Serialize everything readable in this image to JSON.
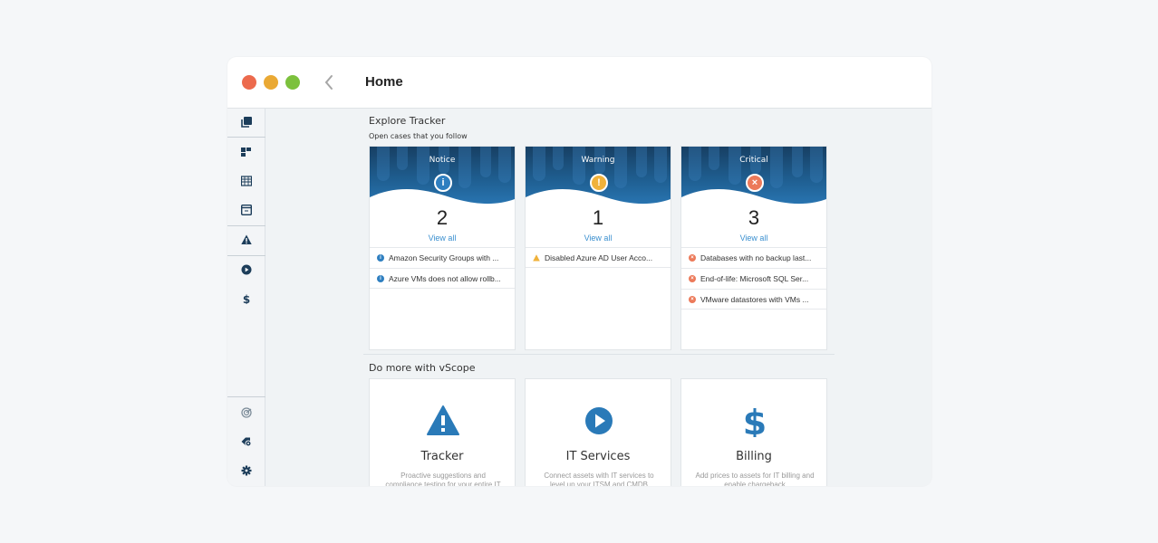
{
  "window": {
    "title": "Home",
    "controls": [
      "close",
      "minimize",
      "maximize"
    ],
    "back_icon": "chevron-left-icon"
  },
  "sidebar": {
    "top_items": [
      {
        "icon": "inventory-icon",
        "label": "Inventory"
      },
      {
        "icon": "dashboards-icon",
        "label": "Dashboards"
      },
      {
        "icon": "table-icon",
        "label": "Tables"
      },
      {
        "icon": "window-icon",
        "label": "Views"
      },
      {
        "icon": "warning-triangle-icon",
        "label": "Tracker"
      },
      {
        "icon": "play-circle-icon",
        "label": "IT Services"
      },
      {
        "icon": "dollar-icon",
        "label": "Billing"
      }
    ],
    "bottom_items": [
      {
        "icon": "discovery-icon",
        "label": "Discovery"
      },
      {
        "icon": "tags-settings-icon",
        "label": "Tags"
      },
      {
        "icon": "gear-icon",
        "label": "Settings"
      }
    ]
  },
  "explore": {
    "title": "Explore Tracker",
    "subtitle": "Open cases that you follow",
    "cards": [
      {
        "label": "Notice",
        "count": "2",
        "view_all": "View all",
        "icon": "info-icon",
        "color": "#2f7fc0",
        "items": [
          "Amazon Security Groups with ...",
          "Azure VMs does not allow rollb..."
        ]
      },
      {
        "label": "Warning",
        "count": "1",
        "view_all": "View all",
        "icon": "warning-icon",
        "color": "#f0b23b",
        "items": [
          "Disabled Azure AD User Acco..."
        ]
      },
      {
        "label": "Critical",
        "count": "3",
        "view_all": "View all",
        "icon": "error-icon",
        "color": "#ec7a5a",
        "items": [
          "Databases with no backup last...",
          "End-of-life: Microsoft SQL Ser...",
          "VMware datastores with VMs ..."
        ]
      }
    ]
  },
  "more": {
    "title": "Do more with vScope",
    "features": [
      {
        "title": "Tracker",
        "desc": "Proactive suggestions and compliance testing for your entire IT",
        "icon": "warning-triangle-icon"
      },
      {
        "title": "IT Services",
        "desc": "Connect assets with IT services to level up your ITSM and CMDB",
        "icon": "play-circle-icon"
      },
      {
        "title": "Billing",
        "desc": "Add prices to assets for IT billing and enable chargeback",
        "icon": "dollar-icon"
      }
    ],
    "accent": "#2a7ab8"
  }
}
